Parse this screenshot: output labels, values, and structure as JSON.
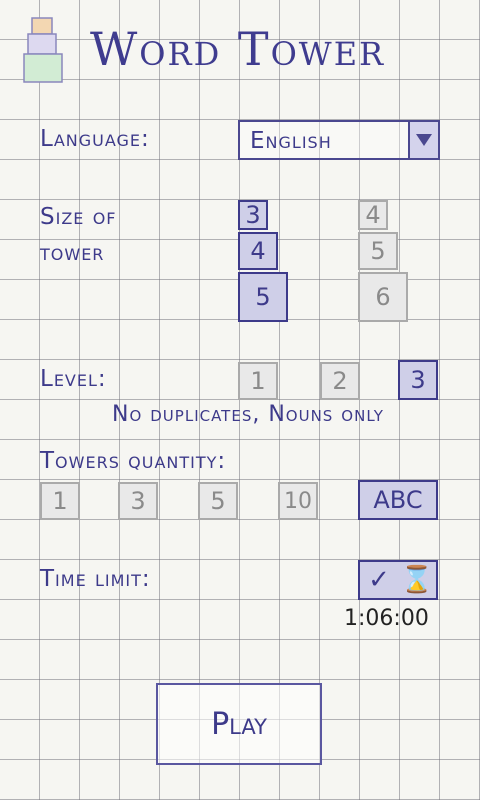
{
  "header": {
    "title": "Word Tower",
    "logo_icon": "stacked-blocks-icon"
  },
  "language": {
    "label": "Language:",
    "value": "English",
    "arrow_icon": "dropdown-triangle-icon"
  },
  "size": {
    "label_line1": "Size of",
    "label_line2": "tower",
    "options": [
      "3",
      "4",
      "5",
      "4",
      "5",
      "6"
    ],
    "selected_column": "left"
  },
  "level": {
    "label": "Level:",
    "options": [
      "1",
      "2",
      "3"
    ],
    "selected": "3",
    "description": "No duplicates, Nouns only"
  },
  "towers_quantity": {
    "label": "Towers quantity:",
    "options": [
      "1",
      "3",
      "5",
      "10"
    ],
    "abc_label": "ABC",
    "selected": "ABC"
  },
  "time_limit": {
    "label": "Time limit:",
    "check_icon": "checkmark-icon",
    "hourglass_icon": "hourglass-icon",
    "check_glyph": "✓",
    "hourglass_glyph": "⌛",
    "value": "1:06:00"
  },
  "play_button": {
    "label": "Play"
  },
  "colors": {
    "ink": "#3d3a8a",
    "tile_selected": "#cfcfe8",
    "tile_off": "#e9e9e9",
    "paper": "#f6f6f2"
  }
}
